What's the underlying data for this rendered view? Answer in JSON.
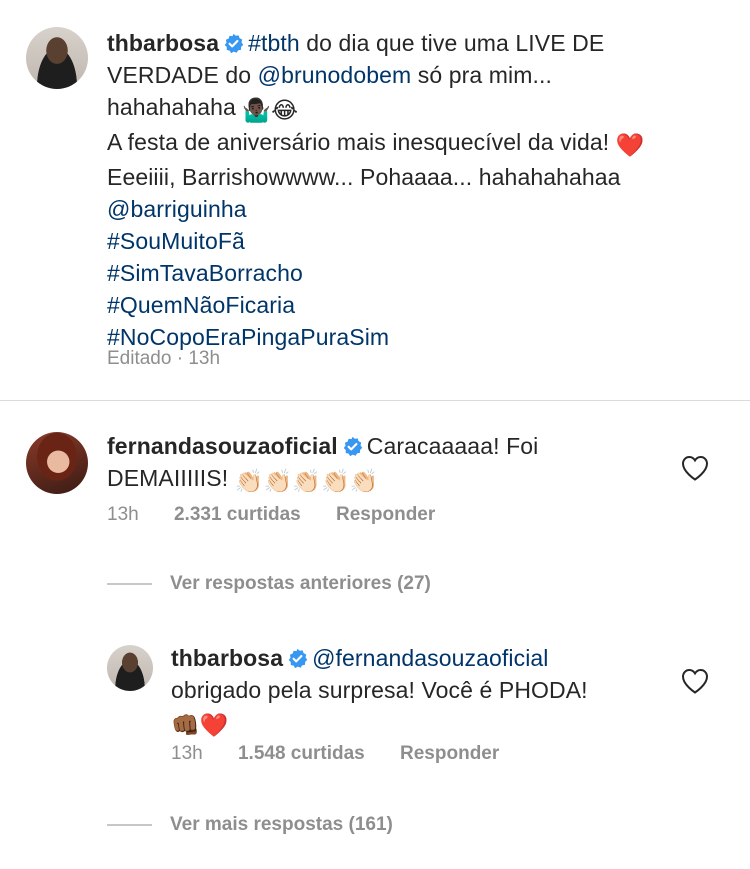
{
  "post": {
    "username": "thbarbosa",
    "line1_tag": "#tbth",
    "line1_text": " do dia que tive uma LIVE DE",
    "line2_text": "VERDADE do ",
    "line2_mention": "@brunodobem",
    "line2_tail": " só pra mim...",
    "line3_text": "hahahahaha",
    "line3_emojis": "🤷🏿‍♂️😂",
    "line4_text": "A festa de aniversário mais inesquecível da vida!",
    "line4_emoji": "❤️",
    "line5_text": "Eeeiiii, Barrishowwww... Pohaaaa... hahahahahaa",
    "mention2": "@barriguinha",
    "hashtags": [
      "#SouMuitoFã",
      "#SimTavaBorracho",
      "#QuemNãoFicaria",
      "#NoCopoEraPingaPuraSim"
    ],
    "edited_label": "Editado · 13h"
  },
  "comment1": {
    "username": "fernandasouzaoficial",
    "text_line1": "Caracaaaaa! Foi",
    "text_line2": "DEMAIIIIIS!",
    "emojis": "👏🏻👏🏻👏🏻👏🏻👏🏻",
    "time": "13h",
    "likes": "2.331 curtidas",
    "reply_label": "Responder"
  },
  "previous_replies": "Ver respostas anteriores (27)",
  "reply1": {
    "username": "thbarbosa",
    "mention": "@fernandasouzaoficial",
    "text_line1": "obrigado pela surpresa! Você é PHODA!",
    "emojis": "👊🏾❤️",
    "time": "13h",
    "likes": "1.548 curtidas",
    "reply_label": "Responder"
  },
  "more_replies": "Ver mais respostas (161)",
  "colors": {
    "link": "#003569",
    "text": "#262626",
    "meta": "#8e8e8e",
    "verified": "#3897f0",
    "divider": "#dbdbdb"
  }
}
